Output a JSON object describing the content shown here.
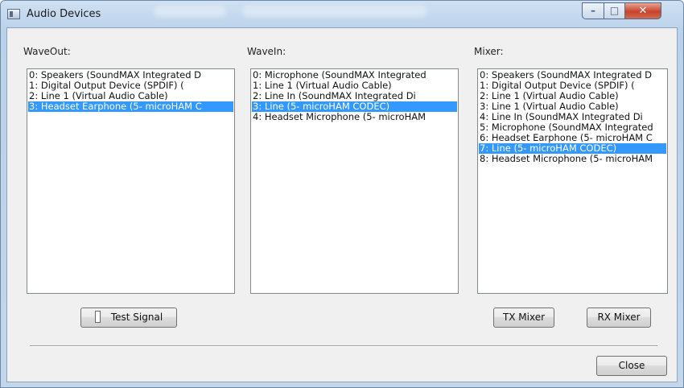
{
  "window": {
    "title": "Audio Devices"
  },
  "waveout": {
    "label": "WaveOut:",
    "items": [
      "0: Speakers (SoundMAX Integrated D",
      "1: Digital Output Device (SPDIF) (",
      "2: Line 1 (Virtual Audio Cable)",
      "3: Headset Earphone (5- microHAM C"
    ],
    "selected_index": 3
  },
  "wavein": {
    "label": "WaveIn:",
    "items": [
      "0: Microphone (SoundMAX Integrated",
      "1: Line 1 (Virtual Audio Cable)",
      "2: Line In (SoundMAX Integrated Di",
      "3: Line (5- microHAM CODEC)",
      "4: Headset Microphone (5- microHAM"
    ],
    "selected_index": 3
  },
  "mixer": {
    "label": "Mixer:",
    "items": [
      "0: Speakers (SoundMAX Integrated D",
      "1: Digital Output Device (SPDIF) (",
      "2: Line 1 (Virtual Audio Cable)",
      "3: Line 1 (Virtual Audio Cable)",
      "4: Line In (SoundMAX Integrated Di",
      "5: Microphone (SoundMAX Integrated",
      "6: Headset Earphone (5- microHAM C",
      "7: Line (5- microHAM CODEC)",
      "8: Headset Microphone (5- microHAM"
    ],
    "selected_index": 7
  },
  "buttons": {
    "test_signal": "Test Signal",
    "tx_mixer": "TX Mixer",
    "rx_mixer": "RX Mixer",
    "close": "Close"
  },
  "colors": {
    "selection": "#3399ff",
    "caption_close": "#c8432a"
  }
}
